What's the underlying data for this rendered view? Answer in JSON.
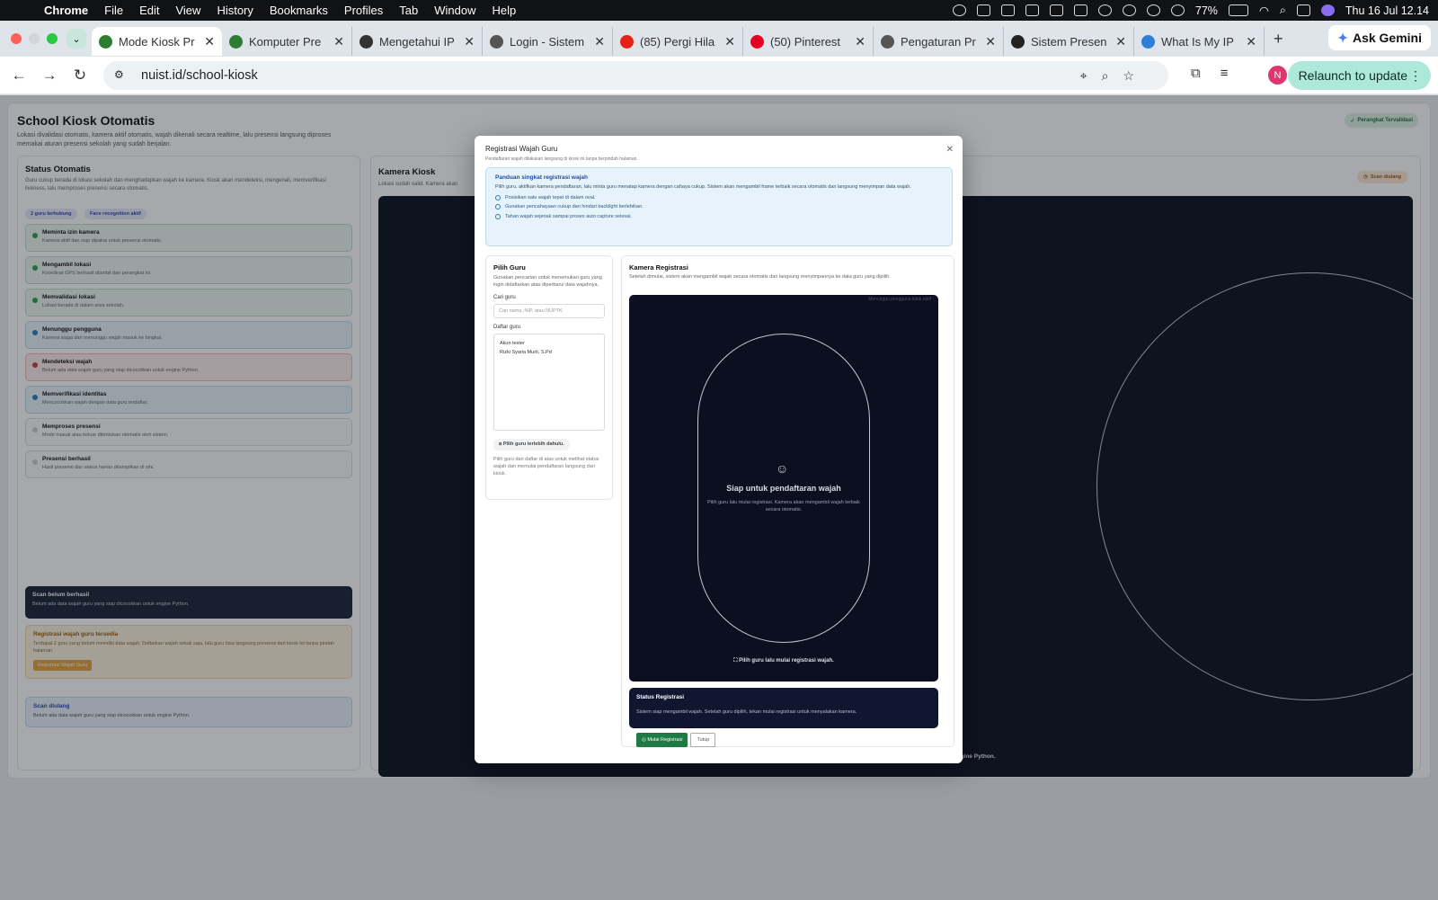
{
  "menubar": {
    "app": "Chrome",
    "items": [
      "File",
      "Edit",
      "View",
      "History",
      "Bookmarks",
      "Profiles",
      "Tab",
      "Window",
      "Help"
    ],
    "battery": "77%",
    "datetime": "Thu 16 Jul  12.14"
  },
  "tabs": [
    {
      "label": "Mode Kiosk Pr",
      "active": true,
      "color": "#2f7d32"
    },
    {
      "label": "Komputer Pre",
      "active": false,
      "color": "#2f7d32"
    },
    {
      "label": "Mengetahui IP",
      "active": false,
      "color": "#333333"
    },
    {
      "label": "Login - Sistem",
      "active": false,
      "color": "#555555"
    },
    {
      "label": "(85) Pergi Hila",
      "active": false,
      "color": "#e62117"
    },
    {
      "label": "(50) Pinterest",
      "active": false,
      "color": "#e60023"
    },
    {
      "label": "Pengaturan Pr",
      "active": false,
      "color": "#555555"
    },
    {
      "label": "Sistem Presen",
      "active": false,
      "color": "#222222"
    },
    {
      "label": "What Is My IP",
      "active": false,
      "color": "#2d7fd8"
    }
  ],
  "gemini": "Ask Gemini",
  "url": "nuist.id/school-kiosk",
  "profile_initial": "N",
  "relaunch": "Relaunch to update",
  "page": {
    "title": "School Kiosk Otomatis",
    "subtitle": "Lokasi divalidasi otomatis, kamera aktif otomatis, wajah dikenali secara realtime, lalu presensi langsung diproses memakai aturan presensi sekolah yang sudah berjalan.",
    "verified": "Perangkat Tervalidasi",
    "status": {
      "title": "Status Otomatis",
      "desc": "Guru cukup berada di lokasi sekolah dan menghadapkan wajah ke kamera. Kiosk akan mendeteksi, mengenali, memverifikasi liveness, lalu memproses presensi secara otomatis.",
      "chips": [
        "2 guru terhubung",
        "Face recognition aktif"
      ],
      "steps": [
        {
          "title": "Meminta izin kamera",
          "desc": "Kamera aktif dan siap dipakai untuk presensi otomatis."
        },
        {
          "title": "Mengambil lokasi",
          "desc": "Koordinat GPS berhasil diambil dari perangkat ini."
        },
        {
          "title": "Memvalidasi lokasi",
          "desc": "Lokasi berada di dalam area sekolah."
        },
        {
          "title": "Menunggu pengguna",
          "desc": "Kamera siaga dan menunggu wajah masuk ke bingkai."
        },
        {
          "title": "Mendeteksi wajah",
          "desc": "Belum ada data wajah guru yang siap dicocokkan untuk engine Python."
        },
        {
          "title": "Memverifikasi identitas",
          "desc": "Mencocokkan wajah dengan data guru terdaftar."
        },
        {
          "title": "Memproses presensi",
          "desc": "Mode masuk atau keluar ditentukan otomatis oleh sistem."
        },
        {
          "title": "Presensi berhasil",
          "desc": "Hasil presensi dan status harian ditampilkan di sini."
        }
      ],
      "fail_title": "Scan belum berhasil",
      "fail_desc": "Belum ada data wajah guru yang siap dicocokkan untuk engine Python.",
      "reg_title": "Registrasi wajah guru tersedia",
      "reg_desc": "Terdapat 2 guru yang belum memiliki data wajah. Daftarkan wajah sekali saja, lalu guru bisa langsung presensi dari kiosk ini tanpa pindah halaman.",
      "reg_btn": "Registrasi Wajah Guru",
      "rescan_title": "Scan diulang",
      "rescan_desc": "Belum ada data wajah guru yang siap dicocokkan untuk engine Python."
    },
    "camera": {
      "title": "Kamera Kiosk",
      "desc": "Lokasi sudah valid. Kamera akan",
      "badge": "Scan diulang",
      "caption": "engine Python."
    }
  },
  "modal": {
    "title": "Registrasi Wajah Guru",
    "subtitle": "Pendaftaran wajah dilakukan langsung di kiosk ini tanpa berpindah halaman.",
    "guide": {
      "title": "Panduan singkat registrasi wajah",
      "desc": "Pilih guru, aktifkan kamera pendaftaran, lalu minta guru menatap kamera dengan cahaya cukup. Sistem akan mengambil frame terbaik secara otomatis dan langsung menyimpan data wajah.",
      "items": [
        "Posisikan satu wajah tepat di dalam oval.",
        "Gunakan pencahayaan cukup dan hindari backlight berlebihan.",
        "Tahan wajah sejenak sampai proses auto capture selesai."
      ]
    },
    "left": {
      "title": "Pilih Guru",
      "desc": "Gunakan pencarian untuk menemukan guru yang ingin didaftarkan atau diperbarui data wajahnya.",
      "search_label": "Cari guru",
      "search_placeholder": "Cari nama, NIP, atau NUPTK",
      "list_label": "Daftar guru",
      "list": [
        "Akun tester",
        "Rizki Syaria Murti, S.Pd"
      ],
      "pick": "Pilih guru terlebih dahulu.",
      "note": "Pilih guru dari daftar di atas untuk melihat status wajah dan memulai pendaftaran langsung dari kiosk."
    },
    "right": {
      "title": "Kamera Registrasi",
      "desc": "Setelah dimulai, sistem akan mengambil wajah secara otomatis dan langsung menyimpannya ke data guru yang dipilih.",
      "corner": "Menunggu pengguna tidak aktif",
      "ready_title": "Siap untuk pendaftaran wajah",
      "ready_desc": "Pilih guru lalu mulai registrasi. Kamera akan mengambil wajah terbaik secara otomatis.",
      "caption": "Pilih guru lalu mulai registrasi wajah.",
      "status_title": "Status Registrasi",
      "status_desc": "Sistem siap mengambil wajah. Setelah guru dipilih, tekan mulai registrasi untuk menyalakan kamera."
    },
    "start_btn": "Mulai Registrasi",
    "close_btn": "Tutup"
  }
}
